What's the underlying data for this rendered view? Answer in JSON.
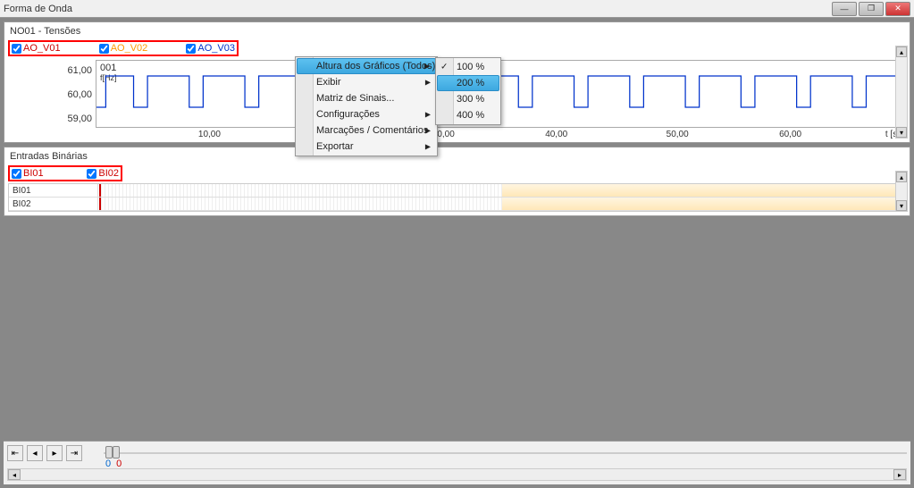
{
  "window": {
    "title": "Forma de Onda"
  },
  "panel1": {
    "title": "NO01 - Tensões",
    "signals": [
      {
        "name": "AO_V01",
        "color": "sig-red"
      },
      {
        "name": "AO_V02",
        "color": "sig-orange"
      },
      {
        "name": "AO_V03",
        "color": "sig-blue"
      }
    ],
    "chart_id": "001",
    "y_unit": "f[Hz]",
    "y_ticks": [
      "61,00",
      "60,00",
      "59,00"
    ],
    "x_unit": "t [s]",
    "x_ticks": [
      {
        "label": "10,00",
        "pct": 14
      },
      {
        "label": "30,00",
        "pct": 43
      },
      {
        "label": "40,00",
        "pct": 57
      },
      {
        "label": "50,00",
        "pct": 72
      },
      {
        "label": "60,00",
        "pct": 86
      }
    ]
  },
  "context_menu": {
    "items": [
      {
        "label": "Altura dos Gráficos (Todos)",
        "arrow": true,
        "highlighted": true
      },
      {
        "label": "Exibir",
        "arrow": true
      },
      {
        "label": "Matriz de Sinais..."
      },
      {
        "label": "Configurações",
        "arrow": true
      },
      {
        "label": "Marcações / Comentários",
        "arrow": true
      },
      {
        "label": "Exportar",
        "arrow": true
      }
    ],
    "submenu": [
      {
        "label": "100 %",
        "checked": true
      },
      {
        "label": "200 %",
        "highlighted": true
      },
      {
        "label": "300 %"
      },
      {
        "label": "400 %"
      }
    ]
  },
  "panel2": {
    "title": "Entradas Binárias",
    "signals": [
      {
        "name": "BI01",
        "color": "sig-red"
      },
      {
        "name": "BI02",
        "color": "sig-red"
      }
    ],
    "rows": [
      "BI01",
      "BI02"
    ]
  },
  "slider": {
    "v1": "0",
    "v2": "0"
  },
  "chart_data": {
    "type": "line",
    "title": "001",
    "ylabel": "f[Hz]",
    "xlabel": "t [s]",
    "ylim": [
      59,
      61
    ],
    "xlim": [
      0,
      70
    ],
    "description": "Square-wave frequency signal toggling between ~59.5 Hz and ~61.0 Hz, approx 14 pulses across 0–70 s"
  }
}
